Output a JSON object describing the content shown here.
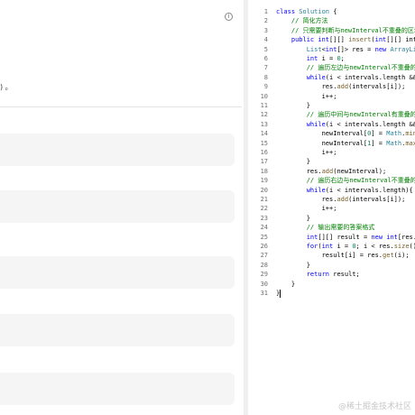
{
  "left_panel": {
    "text_fragment": ") 。",
    "info_icon": "info-circle-icon",
    "cards": [
      "",
      "",
      "",
      "",
      ""
    ]
  },
  "editor": {
    "lines": [
      {
        "n": "1",
        "t": [
          [
            "kw",
            "class "
          ],
          [
            "ty",
            "Solution "
          ],
          [
            "pl",
            "{"
          ]
        ]
      },
      {
        "n": "2",
        "t": [
          [
            "pl",
            "    "
          ],
          [
            "cm",
            "// 简化方法"
          ]
        ]
      },
      {
        "n": "3",
        "t": [
          [
            "pl",
            "    "
          ],
          [
            "cm",
            "// 只需要判断与newInterval不重叠的区域,"
          ]
        ]
      },
      {
        "n": "4",
        "t": [
          [
            "pl",
            "    "
          ],
          [
            "kw",
            "public int"
          ],
          [
            "pl",
            "[][] "
          ],
          [
            "fn",
            "insert"
          ],
          [
            "pl",
            "("
          ],
          [
            "kw",
            "int"
          ],
          [
            "pl",
            "[][] interv"
          ]
        ]
      },
      {
        "n": "5",
        "t": [
          [
            "pl",
            "        "
          ],
          [
            "ty",
            "List"
          ],
          [
            "pl",
            "<"
          ],
          [
            "kw",
            "int"
          ],
          [
            "pl",
            "[]> res = "
          ],
          [
            "kw",
            "new "
          ],
          [
            "ty",
            "ArrayList"
          ]
        ]
      },
      {
        "n": "6",
        "t": [
          [
            "pl",
            "        "
          ],
          [
            "kw",
            "int "
          ],
          [
            "pl",
            "i = "
          ],
          [
            "nm",
            "0"
          ],
          [
            "pl",
            ";"
          ]
        ]
      },
      {
        "n": "7",
        "t": [
          [
            "pl",
            "        "
          ],
          [
            "cm",
            "// 遍历左边与newInterval不重叠的区"
          ]
        ]
      },
      {
        "n": "8",
        "t": [
          [
            "pl",
            "        "
          ],
          [
            "kw",
            "while"
          ],
          [
            "pl",
            "(i < intervals.length && i"
          ]
        ]
      },
      {
        "n": "9",
        "t": [
          [
            "pl",
            "            res."
          ],
          [
            "fn",
            "add"
          ],
          [
            "pl",
            "(intervals[i]);"
          ]
        ]
      },
      {
        "n": "10",
        "t": [
          [
            "pl",
            "            i++;"
          ]
        ]
      },
      {
        "n": "11",
        "t": [
          [
            "pl",
            "        }"
          ]
        ]
      },
      {
        "n": "12",
        "t": [
          [
            "pl",
            "        "
          ],
          [
            "cm",
            "// 遍历中间与newInterval有重叠的部"
          ]
        ]
      },
      {
        "n": "13",
        "t": [
          [
            "pl",
            "        "
          ],
          [
            "kw",
            "while"
          ],
          [
            "pl",
            "(i < intervals.length && i"
          ]
        ]
      },
      {
        "n": "14",
        "t": [
          [
            "pl",
            "            newInterval["
          ],
          [
            "nm",
            "0"
          ],
          [
            "pl",
            "] = "
          ],
          [
            "ty",
            "Math"
          ],
          [
            "pl",
            "."
          ],
          [
            "fn",
            "min"
          ],
          [
            "pl",
            "(n"
          ]
        ]
      },
      {
        "n": "15",
        "t": [
          [
            "pl",
            "            newInterval["
          ],
          [
            "nm",
            "1"
          ],
          [
            "pl",
            "] = "
          ],
          [
            "ty",
            "Math"
          ],
          [
            "pl",
            "."
          ],
          [
            "fn",
            "max"
          ],
          [
            "pl",
            "(n"
          ]
        ]
      },
      {
        "n": "16",
        "t": [
          [
            "pl",
            "            i++;"
          ]
        ]
      },
      {
        "n": "17",
        "t": [
          [
            "pl",
            "        }"
          ]
        ]
      },
      {
        "n": "18",
        "t": [
          [
            "pl",
            "        res."
          ],
          [
            "fn",
            "add"
          ],
          [
            "pl",
            "(newInterval);"
          ]
        ]
      },
      {
        "n": "19",
        "t": [
          [
            "pl",
            "        "
          ],
          [
            "cm",
            "// 遍历右边与newInterval不重叠的区"
          ]
        ]
      },
      {
        "n": "20",
        "t": [
          [
            "pl",
            "        "
          ],
          [
            "kw",
            "while"
          ],
          [
            "pl",
            "(i < intervals.length){"
          ]
        ]
      },
      {
        "n": "21",
        "t": [
          [
            "pl",
            "            res."
          ],
          [
            "fn",
            "add"
          ],
          [
            "pl",
            "(intervals[i]);"
          ]
        ]
      },
      {
        "n": "22",
        "t": [
          [
            "pl",
            "            i++;"
          ]
        ]
      },
      {
        "n": "23",
        "t": [
          [
            "pl",
            "        }"
          ]
        ]
      },
      {
        "n": "24",
        "t": [
          [
            "pl",
            "        "
          ],
          [
            "cm",
            "// 输出需要的答案格式"
          ]
        ]
      },
      {
        "n": "25",
        "t": [
          [
            "pl",
            "        "
          ],
          [
            "kw",
            "int"
          ],
          [
            "pl",
            "[][] result = "
          ],
          [
            "kw",
            "new int"
          ],
          [
            "pl",
            "[res.si"
          ]
        ]
      },
      {
        "n": "26",
        "t": [
          [
            "pl",
            "        "
          ],
          [
            "kw",
            "for"
          ],
          [
            "pl",
            "("
          ],
          [
            "kw",
            "int "
          ],
          [
            "pl",
            "i = "
          ],
          [
            "nm",
            "0"
          ],
          [
            "pl",
            "; i < res."
          ],
          [
            "fn",
            "size"
          ],
          [
            "pl",
            "(); i++)"
          ]
        ]
      },
      {
        "n": "27",
        "t": [
          [
            "pl",
            "            result[i] = res."
          ],
          [
            "fn",
            "get"
          ],
          [
            "pl",
            "(i);"
          ]
        ]
      },
      {
        "n": "28",
        "t": [
          [
            "pl",
            "        }"
          ]
        ]
      },
      {
        "n": "29",
        "t": [
          [
            "pl",
            "        "
          ],
          [
            "kw",
            "return "
          ],
          [
            "pl",
            "result;"
          ]
        ]
      },
      {
        "n": "30",
        "t": [
          [
            "pl",
            "    }"
          ]
        ]
      },
      {
        "n": "31",
        "t": [
          [
            "pl",
            "}"
          ]
        ],
        "cursor": true
      }
    ]
  },
  "watermark": "@稀土掘金技术社区"
}
